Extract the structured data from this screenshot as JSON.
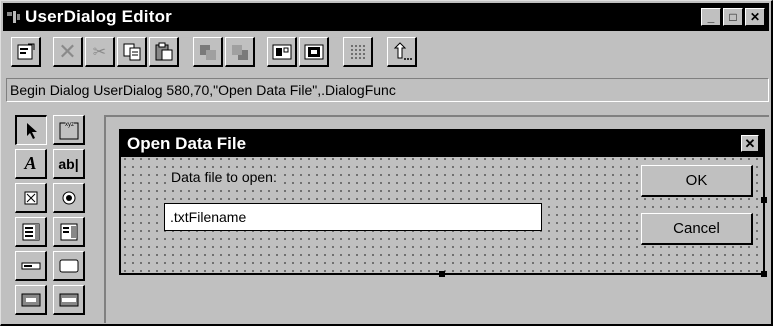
{
  "window": {
    "title": "UserDialog Editor"
  },
  "caption_buttons": [
    "minimize-icon",
    "maximize-icon",
    "close-icon"
  ],
  "toolbar": {
    "buttons": [
      {
        "name": "dialog-info-button",
        "icon": "properties-icon"
      },
      {
        "name": "delete-button",
        "icon": "delete-icon"
      },
      {
        "name": "cut-button",
        "icon": "cut-icon"
      },
      {
        "name": "copy-button",
        "icon": "copy-icon"
      },
      {
        "name": "paste-button",
        "icon": "paste-icon"
      },
      {
        "name": "move-back-button",
        "icon": "move-back-icon"
      },
      {
        "name": "move-forward-button",
        "icon": "move-forward-icon"
      },
      {
        "name": "test-dialog-button",
        "icon": "test-dialog-icon"
      },
      {
        "name": "grid-button",
        "icon": "grid-icon"
      },
      {
        "name": "capture-button",
        "icon": "capture-icon"
      },
      {
        "name": "exit-button",
        "icon": "exit-icon"
      }
    ]
  },
  "command_line": "Begin Dialog UserDialog 580,70,\"Open Data File\",.DialogFunc",
  "palette": {
    "tools": [
      "pointer",
      "group-box",
      "text",
      "text-box",
      "check-box",
      "option-button",
      "list-box",
      "drop-list-box",
      "combo-box",
      "picture",
      "ok-button",
      "cancel-button"
    ],
    "text_glyph": "A",
    "textbox_glyph": "ab|",
    "groupbox_glyph": "xyz"
  },
  "dialog": {
    "title": "Open Data File",
    "label": "Data file to open:",
    "textbox_value": ".txtFilename",
    "ok_label": "OK",
    "cancel_label": "Cancel"
  },
  "colors": {
    "face": "#c0c0c0",
    "title_bg": "#000000",
    "title_fg": "#ffffff"
  }
}
